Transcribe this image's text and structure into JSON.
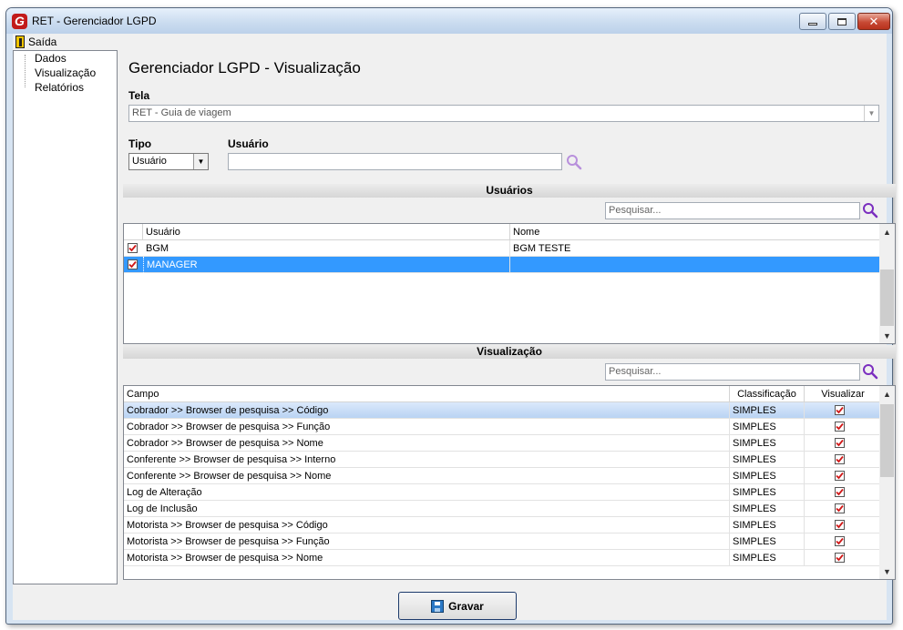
{
  "window": {
    "title": "RET - Gerenciador LGPD",
    "app_icon_letter": "G"
  },
  "menu": {
    "exit_label": "Saída"
  },
  "nav": {
    "items": [
      "Dados",
      "Visualização",
      "Relatórios"
    ]
  },
  "main": {
    "title": "Gerenciador LGPD - Visualização",
    "tela_label": "Tela",
    "tela_value": "RET - Guia de viagem",
    "tipo_label": "Tipo",
    "tipo_value": "Usuário",
    "usuario_label": "Usuário",
    "usuario_value": ""
  },
  "usuarios_section": {
    "title": "Usuários",
    "search_placeholder": "Pesquisar...",
    "columns": [
      "Usuário",
      "Nome"
    ],
    "rows": [
      {
        "checked": true,
        "usuario": "BGM",
        "nome": "BGM TESTE",
        "selected": false
      },
      {
        "checked": true,
        "usuario": "MANAGER",
        "nome": "",
        "selected": true
      }
    ]
  },
  "visualizacao_section": {
    "title": "Visualização",
    "search_placeholder": "Pesquisar...",
    "columns": [
      "Campo",
      "Classificação",
      "Visualizar"
    ],
    "rows": [
      {
        "campo": "Cobrador >> Browser de pesquisa >> Código",
        "classificacao": "SIMPLES",
        "visualizar": true
      },
      {
        "campo": "Cobrador >> Browser de pesquisa >> Função",
        "classificacao": "SIMPLES",
        "visualizar": true
      },
      {
        "campo": "Cobrador >> Browser de pesquisa >> Nome",
        "classificacao": "SIMPLES",
        "visualizar": true
      },
      {
        "campo": "Conferente >> Browser de pesquisa >> Interno",
        "classificacao": "SIMPLES",
        "visualizar": true
      },
      {
        "campo": "Conferente >> Browser de pesquisa >> Nome",
        "classificacao": "SIMPLES",
        "visualizar": true
      },
      {
        "campo": "Log de Alteração",
        "classificacao": "SIMPLES",
        "visualizar": true
      },
      {
        "campo": "Log de Inclusão",
        "classificacao": "SIMPLES",
        "visualizar": true
      },
      {
        "campo": "Motorista >> Browser de pesquisa >> Código",
        "classificacao": "SIMPLES",
        "visualizar": true
      },
      {
        "campo": "Motorista >> Browser de pesquisa >> Função",
        "classificacao": "SIMPLES",
        "visualizar": true
      },
      {
        "campo": "Motorista >> Browser de pesquisa >> Nome",
        "classificacao": "SIMPLES",
        "visualizar": true
      }
    ]
  },
  "footer": {
    "save_label": "Gravar"
  },
  "colors": {
    "selection_blue": "#3399ff",
    "check_red": "#d01818",
    "accent_purple": "#7b2fbf"
  }
}
